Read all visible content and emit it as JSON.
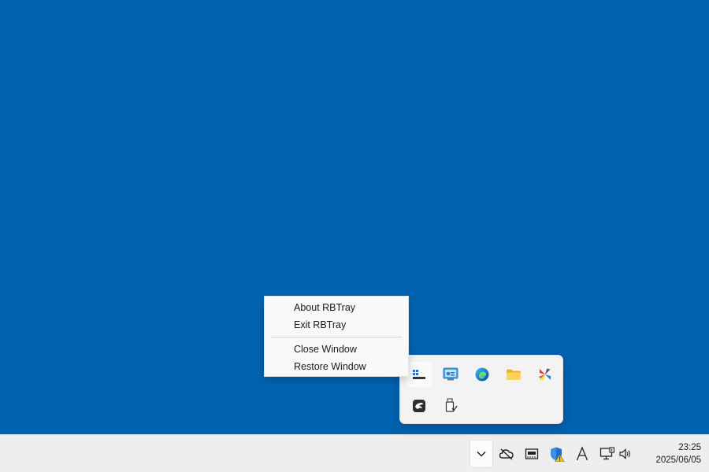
{
  "context_menu": {
    "items": [
      {
        "label": "About RBTray"
      },
      {
        "label": "Exit RBTray"
      },
      {
        "label": "Close Window"
      },
      {
        "label": "Restore Window"
      }
    ]
  },
  "tray_flyout": {
    "icons": [
      "rbtray-icon",
      "network-monitor-icon",
      "edge-icon",
      "folder-icon",
      "colorful-app-icon",
      "dark-app-icon",
      "usb-eject-icon"
    ]
  },
  "taskbar": {
    "tray_icons": [
      "cloud-off-icon",
      "memory-icon",
      "windows-security-icon",
      "font-icon",
      "network-icon",
      "volume-icon"
    ],
    "clock": {
      "time": "23:25",
      "date": "2025/06/05"
    }
  },
  "colors": {
    "desktop": "#0063b1",
    "taskbar": "#eeeeee",
    "menu": "#f9f9f9"
  }
}
